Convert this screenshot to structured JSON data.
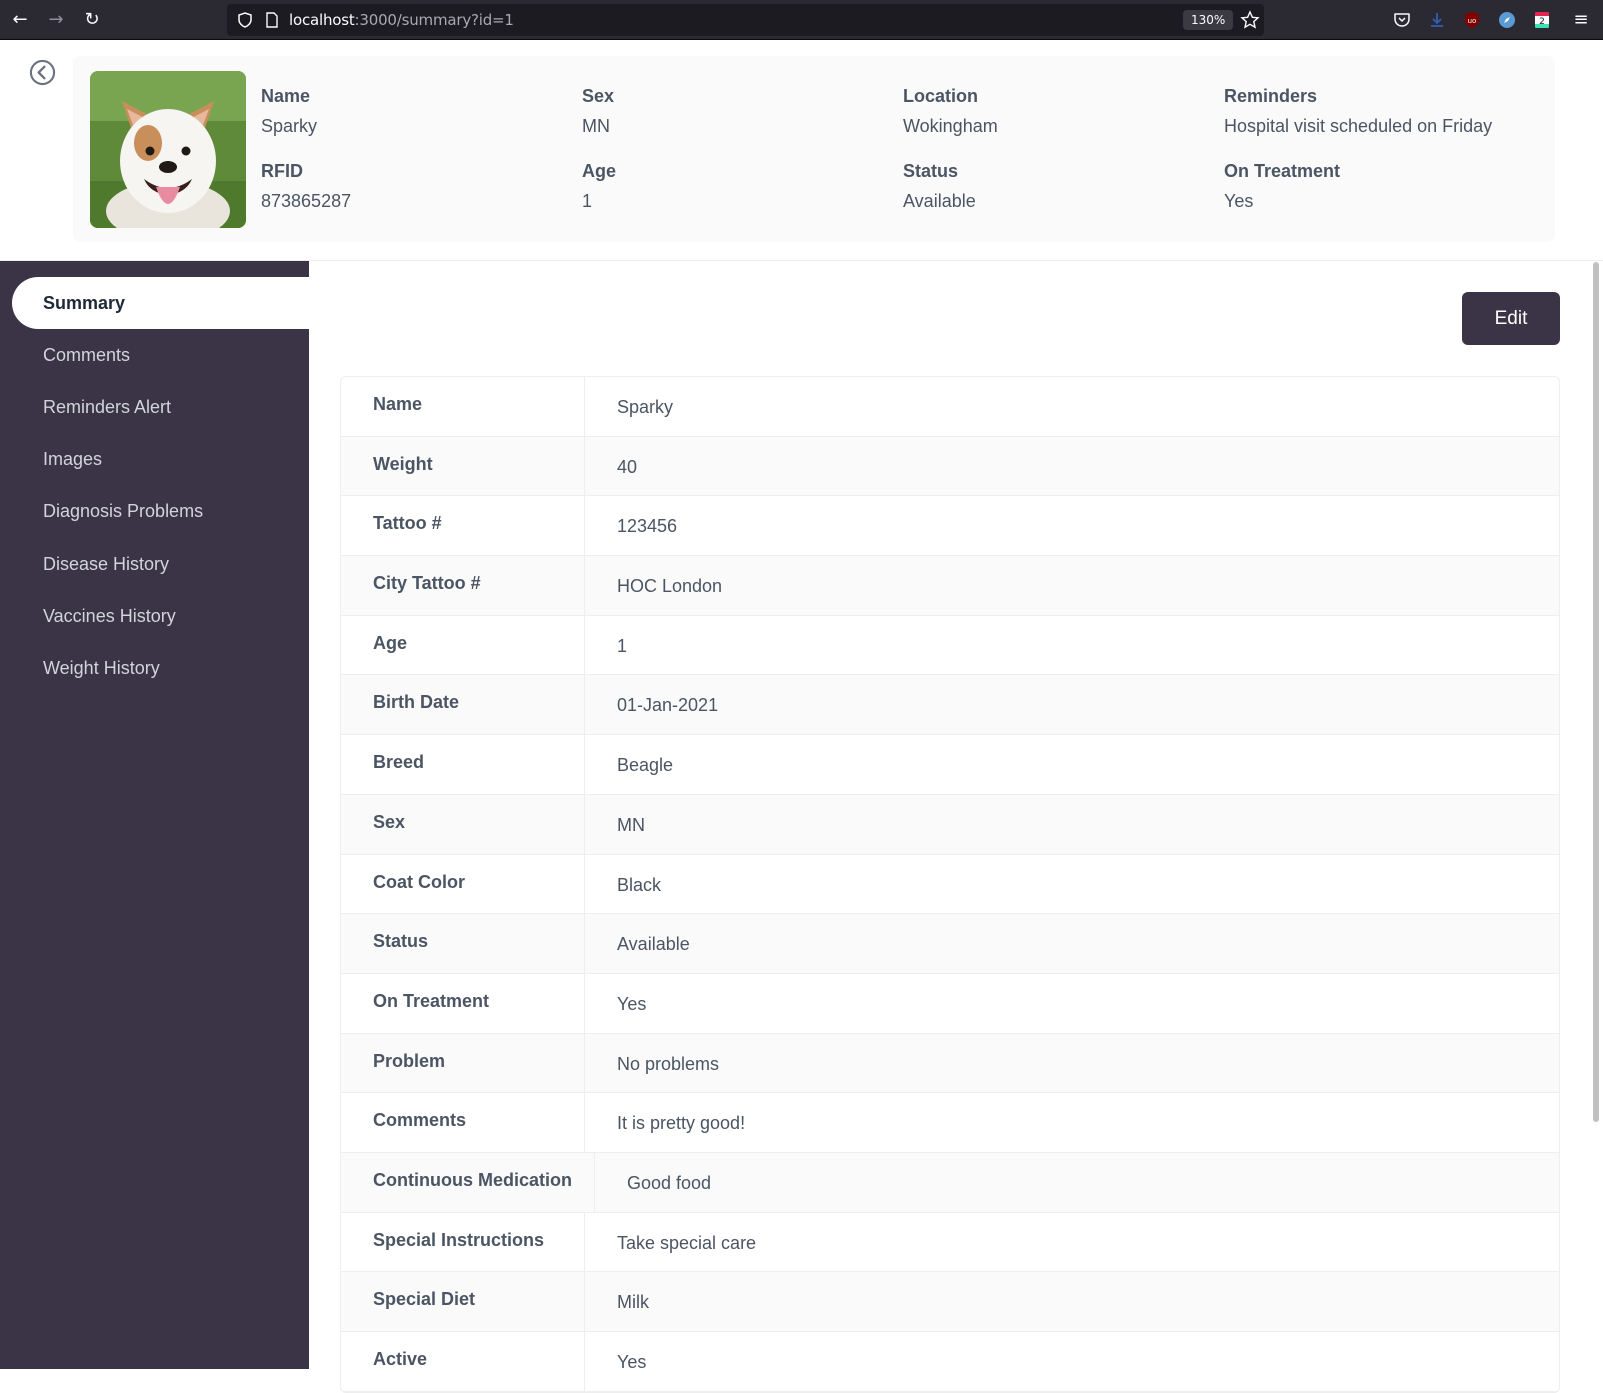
{
  "browser": {
    "url_host": "localhost",
    "url_rest": ":3000/summary?id=1",
    "zoom": "130%"
  },
  "header": {
    "fields": [
      {
        "label": "Name",
        "value": "Sparky"
      },
      {
        "label": "Sex",
        "value": "MN"
      },
      {
        "label": "Location",
        "value": "Wokingham"
      },
      {
        "label": "Reminders",
        "value": "Hospital visit scheduled on Friday"
      },
      {
        "label": "RFID",
        "value": "873865287"
      },
      {
        "label": "Age",
        "value": "1"
      },
      {
        "label": "Status",
        "value": "Available"
      },
      {
        "label": "On Treatment",
        "value": "Yes"
      }
    ]
  },
  "sidebar": {
    "items": [
      {
        "label": "Summary",
        "active": true
      },
      {
        "label": "Comments"
      },
      {
        "label": "Reminders Alert"
      },
      {
        "label": "Images"
      },
      {
        "label": "Diagnosis Problems"
      },
      {
        "label": "Disease History"
      },
      {
        "label": "Vaccines History"
      },
      {
        "label": "Weight History"
      }
    ]
  },
  "main": {
    "edit_label": "Edit",
    "details": [
      {
        "key": "Name",
        "value": "Sparky"
      },
      {
        "key": "Weight",
        "value": "40"
      },
      {
        "key": "Tattoo #",
        "value": "123456"
      },
      {
        "key": "City Tattoo #",
        "value": "HOC London"
      },
      {
        "key": "Age",
        "value": "1"
      },
      {
        "key": "Birth Date",
        "value": "01-Jan-2021"
      },
      {
        "key": "Breed",
        "value": "Beagle"
      },
      {
        "key": "Sex",
        "value": "MN"
      },
      {
        "key": "Coat Color",
        "value": "Black"
      },
      {
        "key": "Status",
        "value": "Available"
      },
      {
        "key": "On Treatment",
        "value": "Yes"
      },
      {
        "key": "Problem",
        "value": "No problems"
      },
      {
        "key": "Comments",
        "value": "It is pretty good!"
      },
      {
        "key": "Continuous Medication",
        "value": "Good food"
      },
      {
        "key": "Special Instructions",
        "value": "Take special care"
      },
      {
        "key": "Special Diet",
        "value": "Milk"
      },
      {
        "key": "Active",
        "value": "Yes"
      }
    ]
  },
  "colors": {
    "sidebar_bg": "#3a3446",
    "accent": "#3a3446"
  }
}
